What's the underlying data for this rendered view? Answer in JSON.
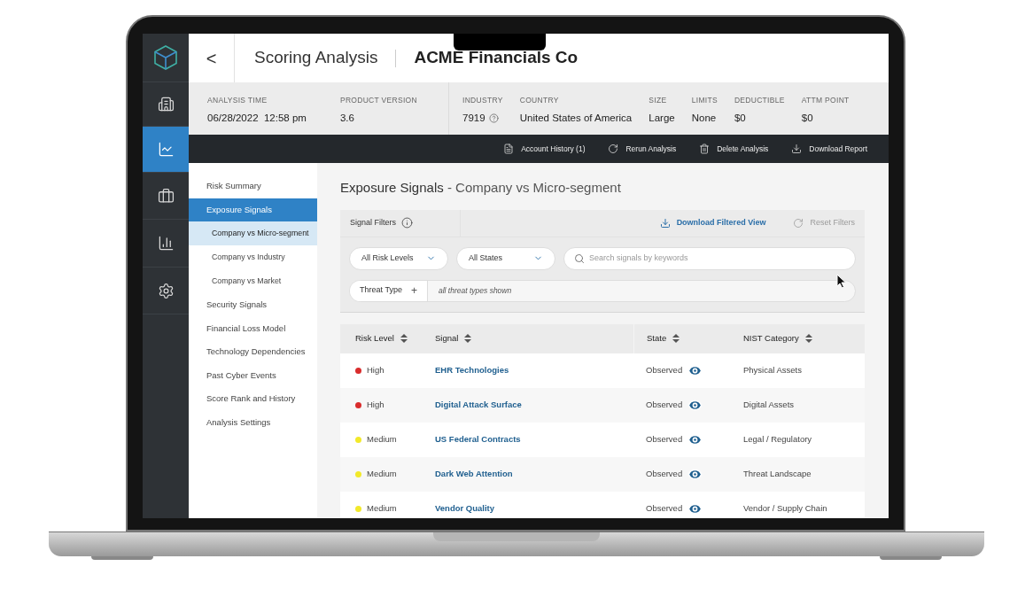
{
  "rail": [
    {
      "kind": "logo"
    },
    {
      "kind": "building",
      "selected": false
    },
    {
      "kind": "trend",
      "selected": true
    },
    {
      "kind": "briefcase",
      "selected": false
    },
    {
      "kind": "bars",
      "selected": false
    },
    {
      "kind": "gear",
      "selected": false
    }
  ],
  "header": {
    "back": "<",
    "title": "Scoring Analysis",
    "company": "ACME Financials Co"
  },
  "info_left": [
    {
      "label": "ANALYSIS TIME",
      "value": "06/28/2022  12:58 pm"
    },
    {
      "label": "PRODUCT VERSION",
      "value": "3.6"
    }
  ],
  "info_right": [
    {
      "label": "INDUSTRY",
      "value": "7919",
      "help": true
    },
    {
      "label": "COUNTRY",
      "value": "United States of America",
      "help": false
    },
    {
      "label": "SIZE",
      "value": "Large",
      "help": false
    },
    {
      "label": "LIMITS",
      "value": "None",
      "help": false
    },
    {
      "label": "DEDUCTIBLE",
      "value": "$0",
      "help": false
    },
    {
      "label": "ATTM POINT",
      "value": "$0",
      "help": false
    }
  ],
  "actions": [
    {
      "kind": "history",
      "label": "Account History (1)"
    },
    {
      "kind": "rerun",
      "label": "Rerun Analysis"
    },
    {
      "kind": "delete",
      "label": "Delete Analysis"
    },
    {
      "kind": "download",
      "label": "Download Report"
    }
  ],
  "nav": [
    {
      "label": "Risk Summary",
      "selected": false
    },
    {
      "label": "Exposure Signals",
      "selected": true,
      "children": [
        {
          "label": "Company vs Micro-segment",
          "selected": true
        },
        {
          "label": "Company vs Industry",
          "selected": false
        },
        {
          "label": "Company vs Market",
          "selected": false
        }
      ]
    },
    {
      "label": "Security Signals",
      "selected": false
    },
    {
      "label": "Financial Loss Model",
      "selected": false
    },
    {
      "label": "Technology Dependencies",
      "selected": false
    },
    {
      "label": "Past Cyber Events",
      "selected": false
    },
    {
      "label": "Score Rank and History",
      "selected": false
    },
    {
      "label": "Analysis Settings",
      "selected": false
    }
  ],
  "page_title": {
    "main": "Exposure Signals",
    "separator": "-",
    "sub": "Company vs Micro-segment"
  },
  "filters": {
    "title": "Signal Filters",
    "download": {
      "label": "Download Filtered View",
      "disabled": false
    },
    "reset": {
      "label": "Reset Filters",
      "disabled": true
    },
    "dropdowns": [
      "All Risk Levels",
      "All States"
    ],
    "search": {
      "placeholder": "Search signals by keywords"
    },
    "threat_type": {
      "label": "Threat Type",
      "add": "+",
      "value": "all threat types shown"
    }
  },
  "table": {
    "columns": [
      "Risk Level",
      "Signal",
      "State",
      "NIST Category"
    ],
    "rows": [
      {
        "risk": "High",
        "color": "#d92c2c",
        "signal": "EHR Technologies",
        "state": "Observed",
        "category": "Physical Assets"
      },
      {
        "risk": "High",
        "color": "#d92c2c",
        "signal": "Digital Attack Surface",
        "state": "Observed",
        "category": "Digital Assets"
      },
      {
        "risk": "Medium",
        "color": "#f2e92a",
        "signal": "US Federal Contracts",
        "state": "Observed",
        "category": "Legal / Regulatory"
      },
      {
        "risk": "Medium",
        "color": "#f2e92a",
        "signal": "Dark Web Attention",
        "state": "Observed",
        "category": "Threat Landscape"
      },
      {
        "risk": "Medium",
        "color": "#f2e92a",
        "signal": "Vendor Quality",
        "state": "Observed",
        "category": "Vendor / Supply Chain"
      }
    ]
  }
}
